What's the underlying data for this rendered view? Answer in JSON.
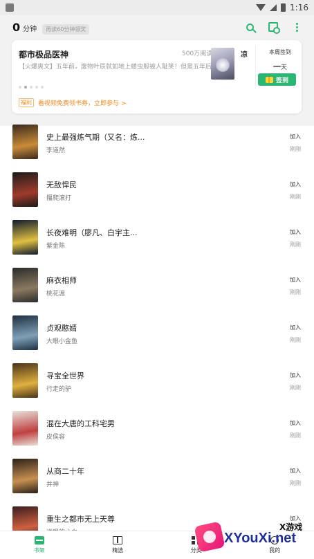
{
  "status_bar": {
    "time": "1:16"
  },
  "header": {
    "reading_time_value": "0",
    "reading_time_unit": "分钟",
    "reading_time_hint": "再读60分钟领奖"
  },
  "featured": {
    "title": "都市极品医神",
    "reads": "500万阅读",
    "trailing_title": "凉",
    "description": "【火爆爽文】五年前，废物叶辰就如地上蝼虫般被人耻笑！但是五年后，他带着一百位上古大能回来了！吊打一切，谁与争锋！",
    "dots_count": 5,
    "active_dot": 1,
    "signin_label": "本周签到",
    "signin_days_value": "一",
    "signin_days_unit": "天",
    "signin_button": "签到",
    "benefit_tag": "福利",
    "benefit_text": "看视频免费领书券，立即参与 >"
  },
  "books": [
    {
      "title": "史上最强炼气期（又名：炼...",
      "author": "李道然",
      "action": "加入",
      "status": "刚刚",
      "cover": [
        "#3a2a1e",
        "#c98b3a"
      ]
    },
    {
      "title": "无敌悍民",
      "author": "攥爬滚打",
      "action": "加入",
      "status": "刚刚",
      "cover": [
        "#1c1c1c",
        "#a03a2a"
      ]
    },
    {
      "title": "长夜难明（廖凡、白宇主...",
      "author": "紫金陈",
      "action": "加入",
      "status": "刚刚",
      "cover": [
        "#0e1a2e",
        "#e0c040"
      ]
    },
    {
      "title": "麻衣相师",
      "author": "桃花渡",
      "action": "加入",
      "status": "刚刚",
      "cover": [
        "#2b2b2b",
        "#8a7a60"
      ]
    },
    {
      "title": "贞观憨婿",
      "author": "大眼小金鱼",
      "action": "加入",
      "status": "刚刚",
      "cover": [
        "#1e3040",
        "#7fa0b8"
      ]
    },
    {
      "title": "寻宝全世界",
      "author": "行走的驴",
      "action": "加入",
      "status": "刚刚",
      "cover": [
        "#4a3418",
        "#e0b040"
      ]
    },
    {
      "title": "混在大唐的工科宅男",
      "author": "皮侯容",
      "action": "加入",
      "status": "刚刚",
      "cover": [
        "#e8e0d8",
        "#c04040"
      ]
    },
    {
      "title": "从商二十年",
      "author": "井神",
      "action": "加入",
      "status": "刚刚",
      "cover": [
        "#2a2018",
        "#c89050"
      ]
    },
    {
      "title": "重生之都市无上天尊",
      "author": "逆眼的小白",
      "action": "加入",
      "status": "",
      "cover": [
        "#3a1e1e",
        "#d06040"
      ]
    }
  ],
  "bottom_nav": [
    {
      "label": "书架",
      "icon": "bookshelf-icon",
      "active": true
    },
    {
      "label": "精选",
      "icon": "open-book-icon",
      "active": false
    },
    {
      "label": "分类",
      "icon": "grid-icon",
      "active": false
    },
    {
      "label": "我的",
      "icon": "user-icon",
      "active": false
    }
  ],
  "watermark": {
    "top_text": "X游戏",
    "main_text": "XYouXi.net"
  },
  "colors": {
    "accent": "#2bb673",
    "benefit": "#f08a1c"
  }
}
